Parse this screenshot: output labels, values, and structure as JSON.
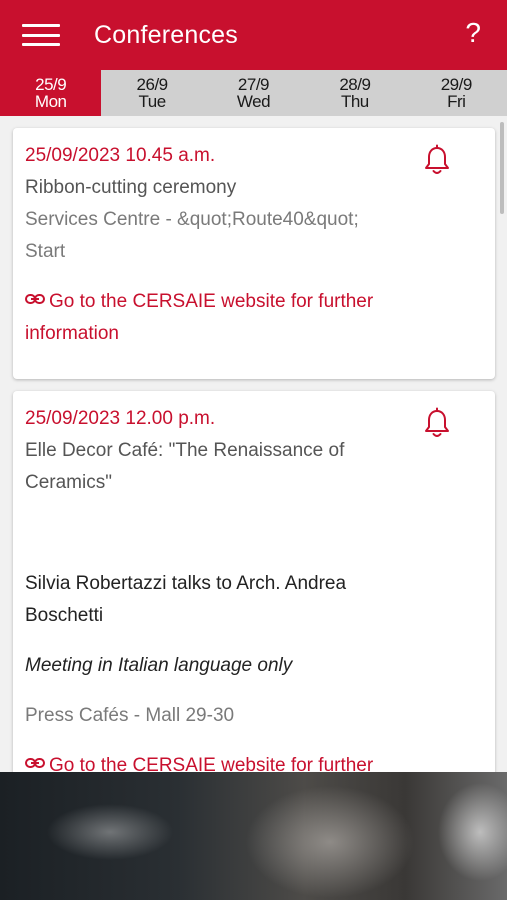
{
  "appbar": {
    "title": "Conferences",
    "menu_icon": "hamburger-menu-icon",
    "help_label": "?"
  },
  "tabs": [
    {
      "date": "25/9",
      "day": "Mon",
      "active": true
    },
    {
      "date": "26/9",
      "day": "Tue",
      "active": false
    },
    {
      "date": "27/9",
      "day": "Wed",
      "active": false
    },
    {
      "date": "28/9",
      "day": "Thu",
      "active": false
    },
    {
      "date": "29/9",
      "day": "Fri",
      "active": false
    }
  ],
  "events": [
    {
      "datetime": "25/09/2023 10.45 a.m.",
      "title": "Ribbon-cutting ceremony",
      "place_line1": "Services Centre - &quot;Route40&quot;",
      "place_line2": "Start",
      "link_line1": "Go to the CERSAIE website for further",
      "link_line2": "information"
    },
    {
      "datetime": "25/09/2023 12.00 p.m.",
      "title_line1": "Elle Decor Café: \"The Renaissance of",
      "title_line2": "Ceramics\"",
      "desc_line1": "Silvia Robertazzi talks to Arch. Andrea",
      "desc_line2": "Boschetti",
      "note": "Meeting in Italian language only",
      "place": "Press Cafés - Mall 29-30",
      "link_line1": "Go to the CERSAIE website for further"
    }
  ],
  "colors": {
    "accent": "#c8102e",
    "tab_bg": "#d0d0d0"
  }
}
